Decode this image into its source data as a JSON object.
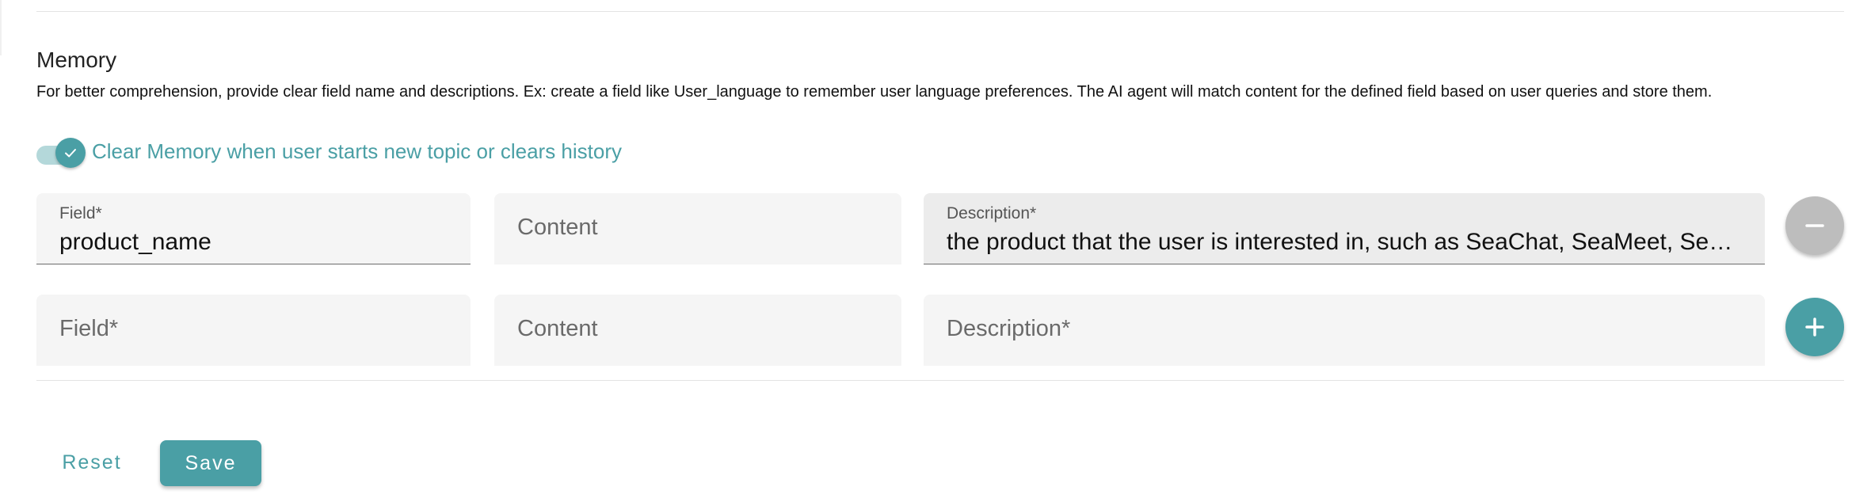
{
  "memory": {
    "title": "Memory",
    "description": "For better comprehension, provide clear field name and descriptions. Ex: create a field like User_language to remember user language preferences. The AI agent will match content for the defined field based on user queries and store them.",
    "toggle": {
      "label": "Clear Memory when user starts new topic or clears history",
      "checked": true
    },
    "rows": [
      {
        "field": {
          "label": "Field*",
          "value": "product_name"
        },
        "content": {
          "placeholder": "Content"
        },
        "description": {
          "label": "Description*",
          "value": "the product that the user is interested in, such as SeaChat, SeaMeet, SeaX ..."
        },
        "action": "remove"
      },
      {
        "field": {
          "placeholder": "Field*"
        },
        "content": {
          "placeholder": "Content"
        },
        "description": {
          "placeholder": "Description*"
        },
        "action": "add"
      }
    ]
  },
  "actions": {
    "reset_label": "Reset",
    "save_label": "Save"
  },
  "colors": {
    "accent": "#4a9fa5",
    "field_bg": "#f5f5f5",
    "remove_button": "#bdbdbd"
  },
  "icons": {
    "toggle_check": "check-icon",
    "remove": "minus-icon",
    "add": "plus-icon"
  }
}
